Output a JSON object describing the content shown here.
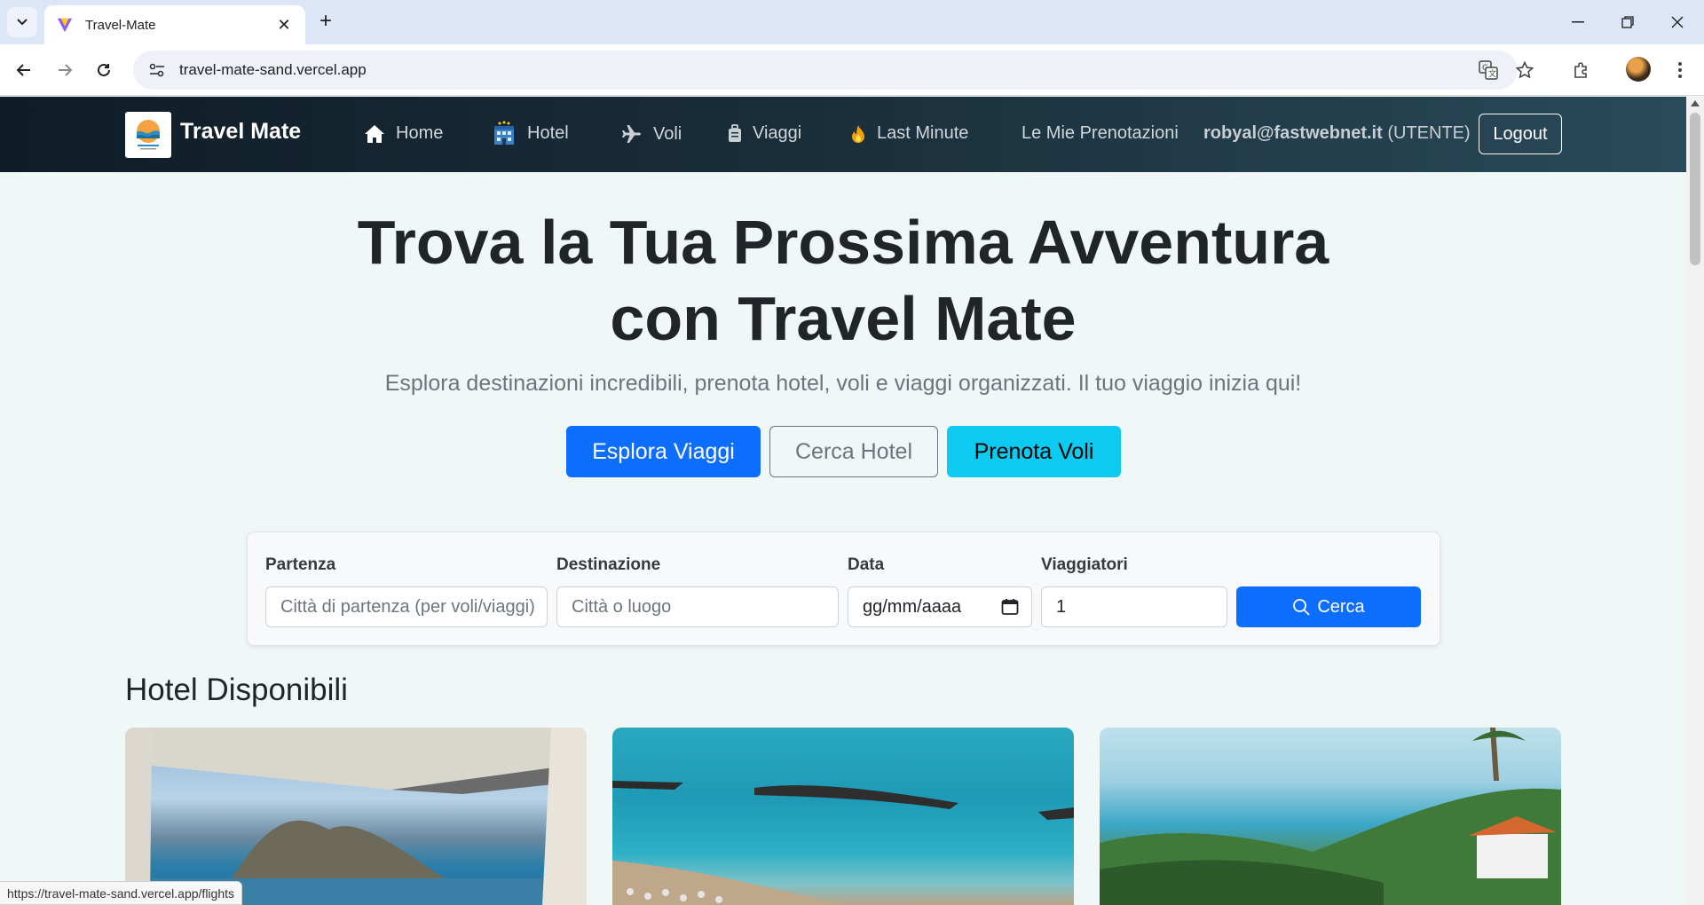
{
  "browser": {
    "tab_title": "Travel-Mate",
    "url": "travel-mate-sand.vercel.app",
    "status_url": "https://travel-mate-sand.vercel.app/flights"
  },
  "navbar": {
    "brand": "Travel Mate",
    "links": [
      {
        "label": "Home",
        "icon": "home-icon"
      },
      {
        "label": "Hotel",
        "icon": "hotel-icon"
      },
      {
        "label": "Voli",
        "icon": "plane-icon"
      },
      {
        "label": "Viaggi",
        "icon": "luggage-icon"
      },
      {
        "label": "Last Minute",
        "icon": "fire-icon"
      },
      {
        "label": "Le Mie Prenotazioni",
        "icon": ""
      }
    ],
    "user_email": "robyal@fastwebnet.it",
    "user_role": "(UTENTE)",
    "logout": "Logout"
  },
  "hero": {
    "title_line1": "Trova la Tua Prossima Avventura",
    "title_line2": "con Travel Mate",
    "subtitle": "Esplora destinazioni incredibili, prenota hotel, voli e viaggi organizzati. Il tuo viaggio inizia qui!",
    "btn_explore": "Esplora Viaggi",
    "btn_hotel": "Cerca Hotel",
    "btn_flights": "Prenota Voli"
  },
  "search": {
    "departure_label": "Partenza",
    "departure_placeholder": "Città di partenza (per voli/viaggi)",
    "destination_label": "Destinazione",
    "destination_placeholder": "Città o luogo",
    "date_label": "Data",
    "date_placeholder": "gg/mm/aaaa",
    "travelers_label": "Viaggiatori",
    "travelers_value": "1",
    "search_button": "Cerca"
  },
  "hotels": {
    "section_title": "Hotel Disponibili"
  },
  "colors": {
    "primary": "#0d6efd",
    "info": "#0dcaf0",
    "navbar_dark": "#0f1c27"
  }
}
